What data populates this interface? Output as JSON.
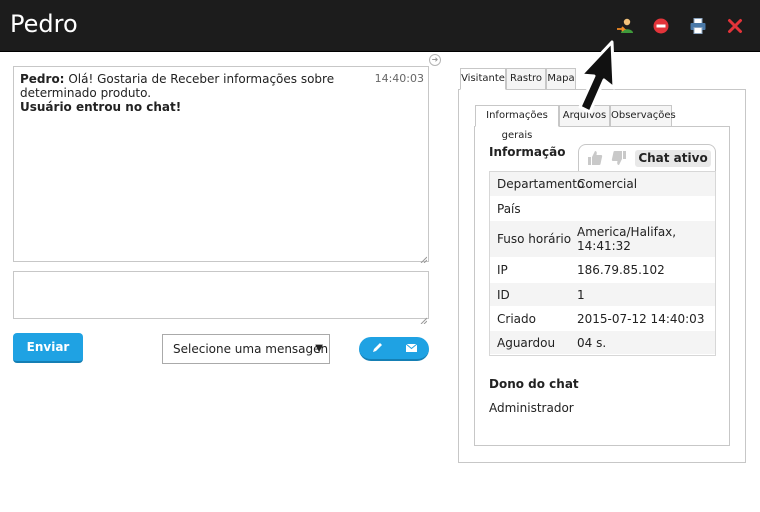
{
  "window": {
    "title": "Pedro"
  },
  "toolbar": {
    "icons": [
      "user-transfer-icon",
      "block-icon",
      "print-icon",
      "close-icon"
    ],
    "colors": {
      "block": "#e3343a",
      "close": "#e3343a",
      "print": "#4a79a8"
    }
  },
  "chat": {
    "messages": [
      {
        "author": "Pedro:",
        "text": "Olá! Gostaria de Receber informações sobre determinado produto.",
        "time": "14:40:03"
      }
    ],
    "system_message": "Usuário entrou no chat!"
  },
  "composer": {
    "send_label": "Enviar",
    "canned_select": "Selecione uma mensagen",
    "pill_icons": [
      "pencil-icon",
      "envelope-icon"
    ]
  },
  "right": {
    "tabs": [
      "Visitante",
      "Rastro",
      "Mapa"
    ],
    "subtabs": [
      "Informações gerais",
      "Arquivos",
      "Observações"
    ],
    "info_title": "Informação",
    "chat_status": "Chat ativo",
    "rows": [
      {
        "k": "Departamento",
        "v": "Comercial"
      },
      {
        "k": "País",
        "v": ""
      },
      {
        "k": "Fuso horário",
        "v": "America/Halifax, 14:41:32"
      },
      {
        "k": "IP",
        "v": "186.79.85.102"
      },
      {
        "k": "ID",
        "v": "1"
      },
      {
        "k": "Criado",
        "v": "2015-07-12 14:40:03"
      },
      {
        "k": "Aguardou",
        "v": "04 s."
      }
    ],
    "owner_title": "Dono do chat",
    "owner_name": "Administrador"
  },
  "colors": {
    "accent": "#1fa2e3",
    "titlebar": "#1c1c1c"
  }
}
